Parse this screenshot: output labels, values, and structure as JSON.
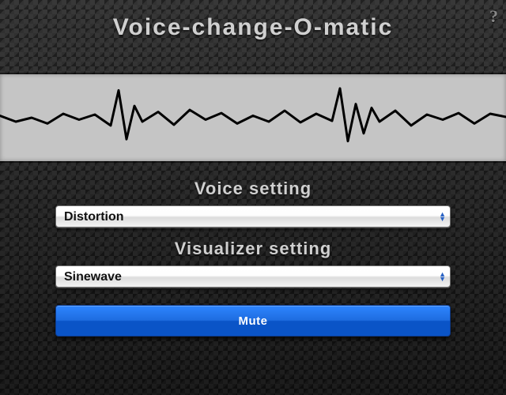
{
  "title": "Voice-change-O-matic",
  "help_tooltip": "?",
  "voice_setting": {
    "label": "Voice setting",
    "selected": "Distortion"
  },
  "visualizer_setting": {
    "label": "Visualizer setting",
    "selected": "Sinewave"
  },
  "mute_button": {
    "label": "Mute"
  },
  "colors": {
    "background": "#2a2a2a",
    "text": "#d0d0d0",
    "wave_bg": "#c5c5c5",
    "button_top": "#2e85ff",
    "button_bottom": "#0a54c7"
  },
  "chart_data": {
    "type": "line",
    "title": "",
    "xlabel": "",
    "ylabel": "",
    "xlim": [
      0,
      640
    ],
    "ylim": [
      -1,
      1
    ],
    "series": [
      {
        "name": "waveform",
        "x": [
          0,
          20,
          40,
          60,
          80,
          100,
          120,
          140,
          150,
          160,
          170,
          180,
          200,
          220,
          240,
          260,
          280,
          300,
          320,
          340,
          360,
          380,
          400,
          420,
          430,
          440,
          450,
          460,
          470,
          480,
          500,
          520,
          540,
          560,
          580,
          600,
          620,
          640
        ],
        "y": [
          0.05,
          -0.1,
          0.0,
          -0.15,
          0.1,
          -0.05,
          0.08,
          -0.2,
          0.7,
          -0.55,
          0.3,
          -0.1,
          0.15,
          -0.18,
          0.2,
          -0.05,
          0.12,
          -0.15,
          0.05,
          -0.1,
          0.18,
          -0.12,
          0.1,
          -0.08,
          0.75,
          -0.6,
          0.35,
          -0.4,
          0.25,
          -0.1,
          0.18,
          -0.2,
          0.08,
          -0.05,
          0.12,
          -0.15,
          0.1,
          0.02
        ]
      }
    ]
  }
}
